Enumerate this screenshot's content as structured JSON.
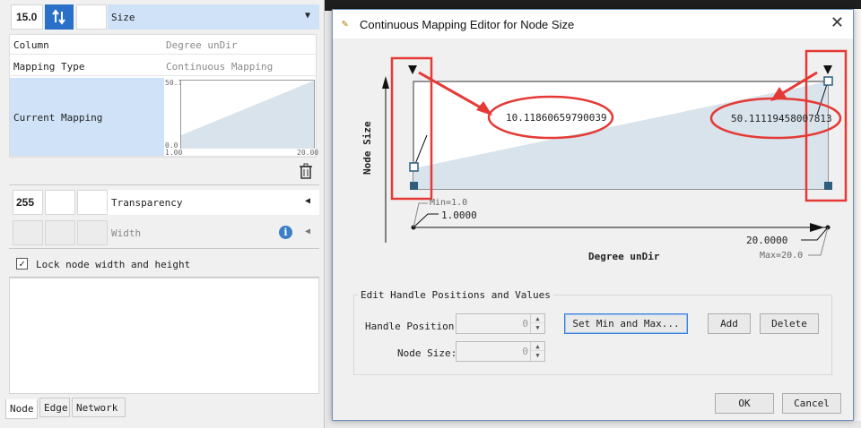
{
  "left_panel": {
    "size_row": {
      "value": "15.0",
      "label": "Size",
      "dropdown_icon": "triangle-down"
    },
    "table": {
      "column_label": "Column",
      "column_value": "Degree unDir",
      "mapping_type_label": "Mapping Type",
      "mapping_type_value": "Continuous Mapping",
      "current_mapping_label": "Current Mapping",
      "mini_chart": {
        "y_max": "50.1",
        "y_min": "0.0",
        "x_min": "1.00",
        "x_max": "20.00"
      }
    },
    "transparency_row": {
      "value": "255",
      "label": "Transparency"
    },
    "width_row": {
      "label": "Width"
    },
    "lock_checkbox": {
      "label": "Lock node width and height",
      "checked": true
    },
    "tabs": [
      "Node",
      "Edge",
      "Network"
    ]
  },
  "dialog": {
    "title": "Continuous Mapping Editor for Node Size",
    "chart": {
      "y_axis_label": "Node Size",
      "x_axis_label": "Degree unDir",
      "left_handle_value": "10.11860659790039",
      "right_handle_value": "50.11119458007813",
      "min_label": "Min=1.0",
      "min_value": "1.0000",
      "max_label": "Max=20.0",
      "max_value": "20.0000"
    },
    "edit_group": {
      "legend": "Edit Handle Positions and Values",
      "handle_position_label": "Handle Position:",
      "handle_position_value": "0",
      "node_size_label": "Node Size:",
      "node_size_value": "0",
      "set_min_max_button": "Set Min and Max...",
      "add_button": "Add",
      "delete_button": "Delete"
    },
    "ok_button": "OK",
    "cancel_button": "Cancel"
  },
  "colors": {
    "annotation_red": "#e53935",
    "selection_blue": "#cfe2f7",
    "chart_fill": "#d8e3ec",
    "handle_dark": "#2f5d7c"
  }
}
